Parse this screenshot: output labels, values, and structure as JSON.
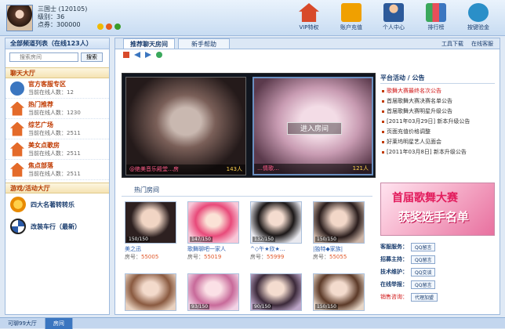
{
  "user": {
    "name": "三国士 (120105)",
    "level": "级别：36",
    "points": "点券：300000"
  },
  "toolbar": {
    "buttons": [
      "VIP特权",
      "账户充值",
      "个人中心",
      "排行榜",
      "按键验金"
    ]
  },
  "sidebar": {
    "title": "全部频道列表（在线123人）",
    "search_placeholder": "搜索房间",
    "search_btn": "搜索",
    "section_chat": "聊天大厅",
    "rooms": [
      {
        "name": "官方客服专区",
        "online": "当前在线人数：12"
      },
      {
        "name": "热门推荐",
        "online": "当前在线人数：1230"
      },
      {
        "name": "综艺广场",
        "online": "当前在线人数：2511"
      },
      {
        "name": "美女点歌房",
        "online": "当前在线人数：2511"
      },
      {
        "name": "焦点部落",
        "online": "当前在线人数：2511"
      }
    ],
    "section_game": "游戏/活动大厅",
    "games": [
      "四大名著转转乐",
      "改装车行（最新）"
    ]
  },
  "tabs": [
    "推荐聊天房间",
    "新手帮助"
  ],
  "tools": [
    "工具下载",
    "在线客服"
  ],
  "banner": {
    "left_caption": "@绝美音乐殿堂…房",
    "left_count": "143人",
    "right_caption": "…情歌…",
    "right_count": "121人",
    "enter": "进入房间"
  },
  "platform": {
    "title": "平台活动 / 公告",
    "items": [
      "歌舞大赛最终名次公告",
      "首届歌舞大赛决赛名单公告",
      "首届歌舞大赛明星升级公告",
      "[2011年03月29日] 新本升级公告",
      "页面充值价格调整",
      "好莱坞明星艺人见面会",
      "[2011年03月8日] 新本升级公告"
    ]
  },
  "hot_rooms": {
    "title": "热门房间",
    "cards": [
      {
        "count": "150/150",
        "name": "美之迅",
        "no": "房号：",
        "num": "55005"
      },
      {
        "count": "147/150",
        "name": "歌舞聊吧一家人",
        "no": "房号：",
        "num": "55019"
      },
      {
        "count": "132/150",
        "name": "^◇午★欣★…",
        "no": "房号：",
        "num": "55999"
      },
      {
        "count": "150/150",
        "name": "|独特◆家族|",
        "no": "房号：",
        "num": "55055"
      }
    ],
    "row2": [
      "",
      "93/150",
      "90/150",
      "150/150"
    ]
  },
  "ad": {
    "line1": "首届歌舞大赛",
    "line2": "获奖选手名单"
  },
  "service": [
    {
      "label": "客服服务：",
      "btn": "QQ留言"
    },
    {
      "label": "招募主持：",
      "btn": "QQ留言"
    },
    {
      "label": "技术维护：",
      "btn": "QQ交谈"
    },
    {
      "label": "在线举报：",
      "btn": "QQ留言"
    }
  ],
  "sell": {
    "label": "销售咨询：",
    "btn": "代理加盟"
  },
  "bottom": {
    "tabs": [
      "可聊99大厅",
      "房间"
    ]
  },
  "colors": {
    "accent": "#3b76c0",
    "hot": "#d01414"
  }
}
